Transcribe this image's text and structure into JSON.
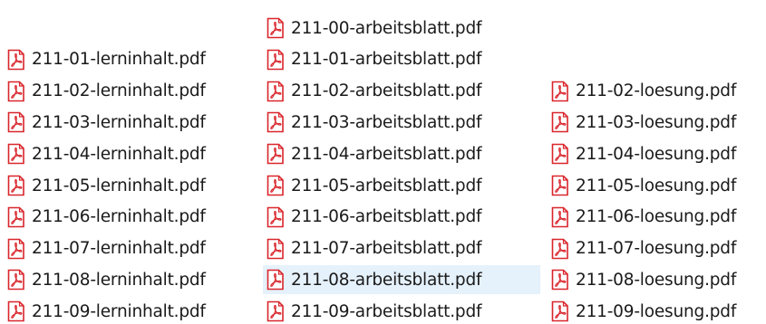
{
  "file_icon": "pdf-file-icon",
  "colors": {
    "icon_red": "#d9262c",
    "selection": "#e5f1fb"
  },
  "columns": [
    {
      "name": "lerninhalt",
      "items": [
        {
          "row": 1,
          "label": "211-01-lerninhalt.pdf"
        },
        {
          "row": 2,
          "label": "211-02-lerninhalt.pdf"
        },
        {
          "row": 3,
          "label": "211-03-lerninhalt.pdf"
        },
        {
          "row": 4,
          "label": "211-04-lerninhalt.pdf"
        },
        {
          "row": 5,
          "label": "211-05-lerninhalt.pdf"
        },
        {
          "row": 6,
          "label": "211-06-lerninhalt.pdf"
        },
        {
          "row": 7,
          "label": "211-07-lerninhalt.pdf"
        },
        {
          "row": 8,
          "label": "211-08-lerninhalt.pdf"
        },
        {
          "row": 9,
          "label": "211-09-lerninhalt.pdf"
        }
      ]
    },
    {
      "name": "arbeitsblatt",
      "items": [
        {
          "row": 0,
          "label": "211-00-arbeitsblatt.pdf"
        },
        {
          "row": 1,
          "label": "211-01-arbeitsblatt.pdf"
        },
        {
          "row": 2,
          "label": "211-02-arbeitsblatt.pdf"
        },
        {
          "row": 3,
          "label": "211-03-arbeitsblatt.pdf"
        },
        {
          "row": 4,
          "label": "211-04-arbeitsblatt.pdf"
        },
        {
          "row": 5,
          "label": "211-05-arbeitsblatt.pdf"
        },
        {
          "row": 6,
          "label": "211-06-arbeitsblatt.pdf"
        },
        {
          "row": 7,
          "label": "211-07-arbeitsblatt.pdf"
        },
        {
          "row": 8,
          "label": "211-08-arbeitsblatt.pdf",
          "selected": true
        },
        {
          "row": 9,
          "label": "211-09-arbeitsblatt.pdf"
        }
      ]
    },
    {
      "name": "loesung",
      "items": [
        {
          "row": 2,
          "label": "211-02-loesung.pdf"
        },
        {
          "row": 3,
          "label": "211-03-loesung.pdf"
        },
        {
          "row": 4,
          "label": "211-04-loesung.pdf"
        },
        {
          "row": 5,
          "label": "211-05-loesung.pdf"
        },
        {
          "row": 6,
          "label": "211-06-loesung.pdf"
        },
        {
          "row": 7,
          "label": "211-07-loesung.pdf"
        },
        {
          "row": 8,
          "label": "211-08-loesung.pdf"
        },
        {
          "row": 9,
          "label": "211-09-loesung.pdf"
        }
      ]
    }
  ]
}
